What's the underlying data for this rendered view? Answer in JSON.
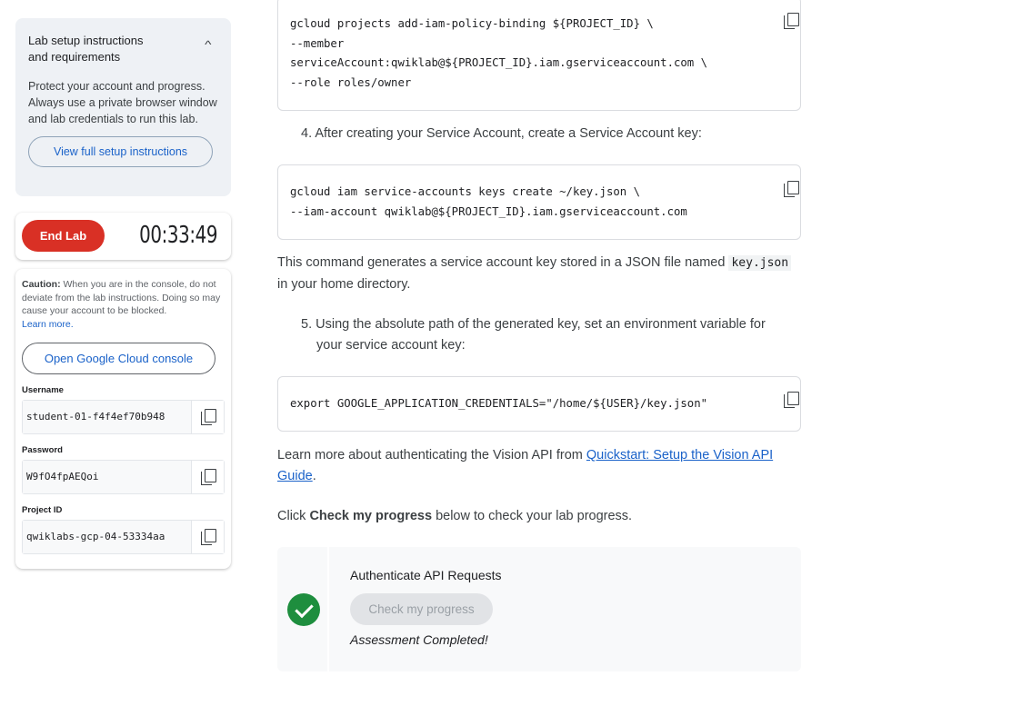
{
  "sidebar": {
    "setup": {
      "title_line1": "Lab setup instructions",
      "title_line2": "and requirements",
      "description": "Protect your account and progress. Always use a private browser window and lab credentials to run this lab.",
      "view_button": "View full setup instructions"
    },
    "timer": {
      "end_button": "End Lab",
      "time": "00:33:49"
    },
    "credentials": {
      "caution_bold": "Caution:",
      "caution_text": " When you are in the console, do not deviate from the lab instructions. Doing so may cause your account to be blocked.",
      "learn_more": "Learn more.",
      "console_button": "Open Google Cloud console",
      "fields": [
        {
          "label": "Username",
          "value": "student-01-f4f4ef70b948"
        },
        {
          "label": "Password",
          "value": "W9fO4fpAEQoi"
        },
        {
          "label": "Project ID",
          "value": "qwiklabs-gcp-04-53334aa"
        }
      ]
    }
  },
  "main": {
    "code1": "gcloud projects add-iam-policy-binding ${PROJECT_ID} \\\n--member\nserviceAccount:qwiklab@${PROJECT_ID}.iam.gserviceaccount.com \\\n--role roles/owner",
    "step4": "4. After creating your Service Account, create a Service Account key:",
    "code2": "gcloud iam service-accounts keys create ~/key.json \\\n--iam-account qwiklab@${PROJECT_ID}.iam.gserviceaccount.com",
    "para1_a": "This command generates a service account key stored in a JSON file named ",
    "para1_code": "key.json",
    "para1_b": "in your home directory.",
    "step5_line1": "5. Using the absolute path of the generated key, set an environment variable for",
    "step5_line2": "your service account key:",
    "code3": "export GOOGLE_APPLICATION_CREDENTIALS=\"/home/${USER}/key.json\"",
    "para2_a": "Learn more about authenticating the Vision API from ",
    "para2_link1": "Quickstart: Setup the Vision API",
    "para2_link2": "Guide",
    "para2_end": ".",
    "para3_a": "Click ",
    "para3_bold": "Check my progress",
    "para3_b": " below to check your lab progress.",
    "progress": {
      "task_title": "Authenticate API Requests",
      "button": "Check my progress",
      "status": "Assessment Completed!",
      "status_color": "#1e8e3e"
    }
  }
}
